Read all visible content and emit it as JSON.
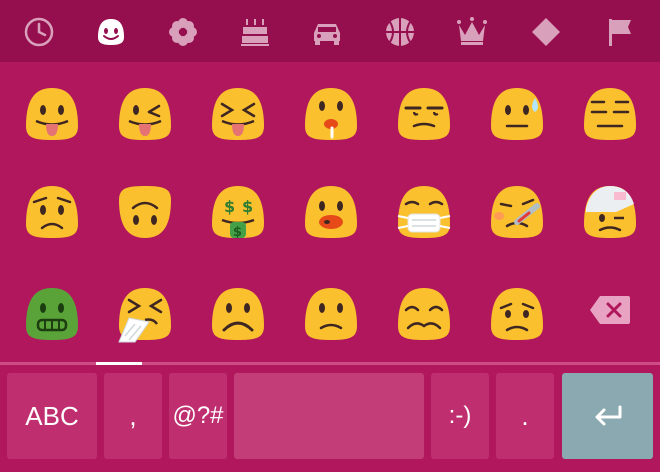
{
  "category_bar": {
    "categories": [
      {
        "name": "recent",
        "icon": "clock-icon"
      },
      {
        "name": "smileys",
        "icon": "smiley-icon",
        "selected": true
      },
      {
        "name": "nature",
        "icon": "flower-icon"
      },
      {
        "name": "celebration",
        "icon": "cake-icon"
      },
      {
        "name": "places",
        "icon": "car-icon"
      },
      {
        "name": "activity",
        "icon": "basketball-icon"
      },
      {
        "name": "objects",
        "icon": "crown-icon"
      },
      {
        "name": "symbols",
        "icon": "diamond-icon"
      },
      {
        "name": "flags",
        "icon": "flag-icon"
      }
    ]
  },
  "emoji_grid": {
    "rows": [
      [
        "tongue-out",
        "winking-tongue",
        "squinting-tongue",
        "drooling",
        "unamused",
        "cold-sweat",
        "pensive"
      ],
      [
        "worried",
        "upside-down",
        "money-mouth",
        "hushed-flushed",
        "medical-mask",
        "thermometer",
        "head-bandage"
      ],
      [
        "nauseated",
        "sneezing",
        "frowning",
        "slightly-frowning",
        "confounded",
        "disappointed"
      ]
    ]
  },
  "bottom_row": {
    "abc_label": "ABC",
    "comma_label": ",",
    "symbols_label": "@?#",
    "emoticon_label": ":-)",
    "period_label": "."
  },
  "colors": {
    "background": "#b0175d",
    "category_bar": "#950f4e",
    "key": "#bf2f6f",
    "enter_key": "#8aa9b0",
    "emoji_yellow": "#fbc02d",
    "nauseated_green": "#5aa339"
  }
}
